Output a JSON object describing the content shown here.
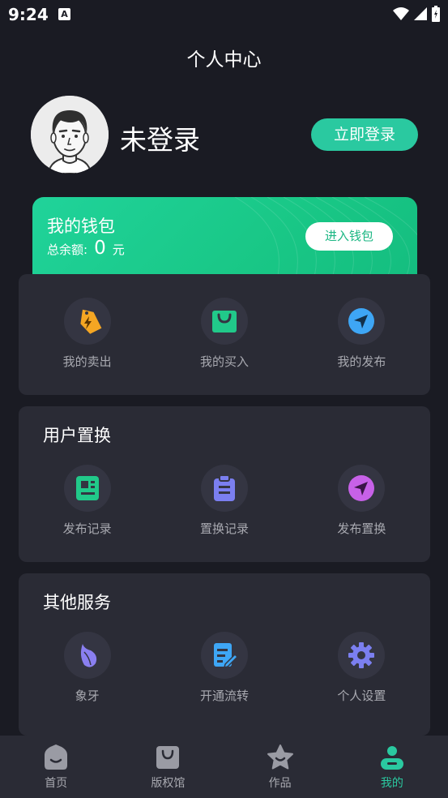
{
  "status_bar": {
    "time": "9:24",
    "notification_glyph": "A"
  },
  "header": {
    "title": "个人中心"
  },
  "profile": {
    "username": "未登录",
    "login_button": "立即登录"
  },
  "wallet": {
    "title": "我的钱包",
    "balance_label": "总余额:",
    "balance_value": "0",
    "currency": "元",
    "enter_button": "进入钱包"
  },
  "trade": {
    "items": [
      {
        "label": "我的卖出",
        "icon": "tag-lightning-icon",
        "color": "#f5a623"
      },
      {
        "label": "我的买入",
        "icon": "shopping-bag-icon",
        "color": "#21c98a"
      },
      {
        "label": "我的发布",
        "icon": "send-icon",
        "color": "#3ea6f5"
      }
    ]
  },
  "exchange": {
    "title": "用户置换",
    "items": [
      {
        "label": "发布记录",
        "icon": "document-icon",
        "color": "#21c98a"
      },
      {
        "label": "置换记录",
        "icon": "clipboard-icon",
        "color": "#7b7ff0"
      },
      {
        "label": "发布置换",
        "icon": "send-icon",
        "color": "#c761e8"
      }
    ]
  },
  "services": {
    "title": "其他服务",
    "items": [
      {
        "label": "象牙",
        "icon": "leaf-icon",
        "color": "#8a7ff0"
      },
      {
        "label": "开通流转",
        "icon": "edit-document-icon",
        "color": "#3ea6f5"
      },
      {
        "label": "个人设置",
        "icon": "gear-icon",
        "color": "#7b7ff0"
      }
    ]
  },
  "bottom_nav": {
    "active_color": "#2ac9a0",
    "items": [
      {
        "label": "首页",
        "icon": "home-icon"
      },
      {
        "label": "版权馆",
        "icon": "bag-icon"
      },
      {
        "label": "作品",
        "icon": "star-icon"
      },
      {
        "label": "我的",
        "icon": "user-icon"
      }
    ]
  }
}
